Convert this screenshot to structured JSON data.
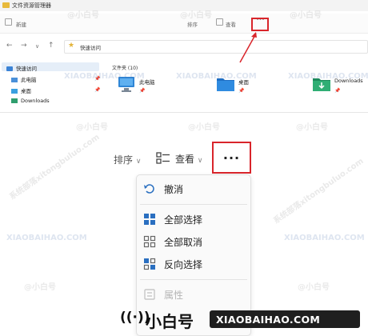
{
  "window": {
    "title": "文件资源管理器"
  },
  "toolbar": {
    "new_label": "新建",
    "sort_label": "排序",
    "view_label": "查看",
    "more_label": "···"
  },
  "addressbar": {
    "back": "←",
    "forward": "→",
    "dropdown": "∨",
    "up": "↑",
    "path": "快速访问"
  },
  "sidebar": {
    "items": [
      {
        "label": "快速访问",
        "icon": "star-icon"
      },
      {
        "label": "此电脑",
        "icon": "computer-icon"
      },
      {
        "label": "桌面",
        "icon": "desktop-icon"
      },
      {
        "label": "Downloads",
        "icon": "downloads-icon"
      }
    ]
  },
  "content": {
    "section": "文件夹 (10)",
    "folders": [
      {
        "name": "此电脑",
        "icon": "computer-icon"
      },
      {
        "name": "桌面",
        "icon": "desktop-folder-icon"
      },
      {
        "name": "Downloads",
        "icon": "downloads-folder-icon"
      }
    ]
  },
  "zoom": {
    "sort_label": "排序",
    "view_label": "查看",
    "more_label": "···"
  },
  "menu": {
    "items": [
      {
        "label": "撤消",
        "icon": "undo-icon"
      },
      {
        "label": "全部选择",
        "icon": "select-all-icon"
      },
      {
        "label": "全部取消",
        "icon": "select-none-icon"
      },
      {
        "label": "反向选择",
        "icon": "invert-selection-icon"
      },
      {
        "label": "属性",
        "icon": "properties-icon"
      }
    ]
  },
  "brand": {
    "name_cn": "小白号",
    "domain": "XIAOBAIHAO.COM"
  },
  "watermarks": {
    "text_cn": "@小白号",
    "text_en": "XIAOBAIHAO.COM",
    "text_pinyin": "系统部落xitongbuluo.com"
  },
  "colors": {
    "highlight_red": "#d9252b",
    "folder_yellow": "#e8b93b",
    "selection_blue": "#e5eef8"
  }
}
